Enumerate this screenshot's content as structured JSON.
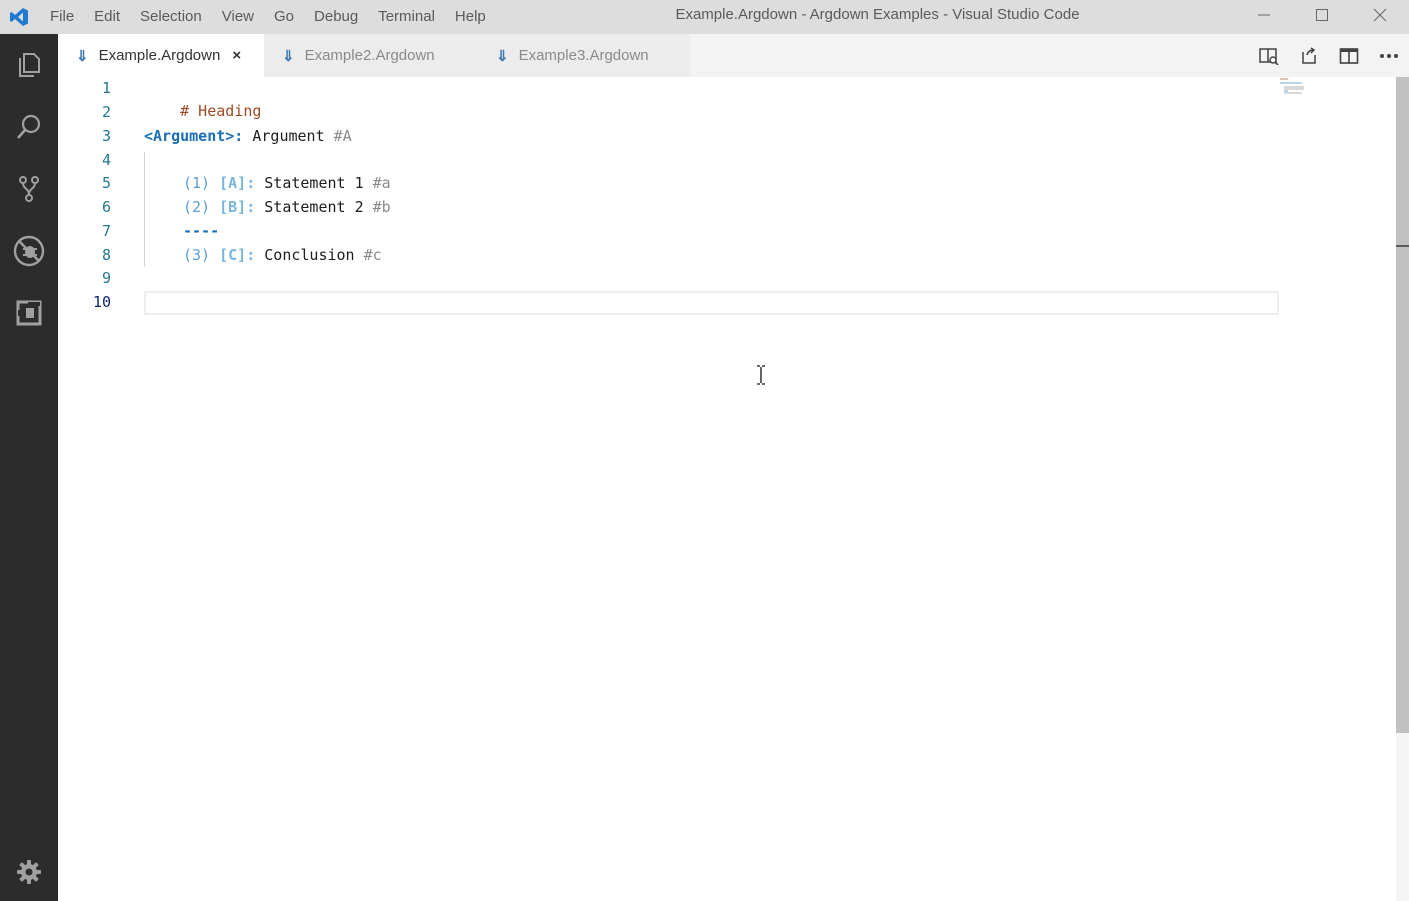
{
  "titlebar": {
    "menu": [
      "File",
      "Edit",
      "Selection",
      "View",
      "Go",
      "Debug",
      "Terminal",
      "Help"
    ],
    "title": "Example.Argdown - Argdown Examples - Visual Studio Code"
  },
  "activitybar": {
    "items": [
      "explorer-icon",
      "search-icon",
      "source-control-icon",
      "debug-icon",
      "extensions-icon"
    ],
    "bottom": "gear-icon"
  },
  "tabs": [
    {
      "label": "Example.Argdown",
      "active": true,
      "close": "×"
    },
    {
      "label": "Example2.Argdown",
      "active": false
    },
    {
      "label": "Example3.Argdown",
      "active": false
    }
  ],
  "editor_actions": [
    "open-preview-icon",
    "open-file-icon",
    "split-editor-icon",
    "more-actions-icon"
  ],
  "editor": {
    "line_numbers": [
      "1",
      "2",
      "3",
      "4",
      "5",
      "6",
      "7",
      "8",
      "9",
      "10"
    ],
    "lines": {
      "l1": {
        "heading": "# Heading"
      },
      "l3": {
        "arg": "<Argument>:",
        "text": " Argument ",
        "tag": "#A"
      },
      "l5": {
        "num": "(1) ",
        "ref": "[A]:",
        "text": " Statement 1 ",
        "tag": "#a"
      },
      "l6": {
        "num": "(2) ",
        "ref": "[B]:",
        "text": " Statement 2 ",
        "tag": "#b"
      },
      "l7": {
        "sep": "----"
      },
      "l8": {
        "num": "(3) ",
        "ref": "[C]:",
        "text": " Conclusion ",
        "tag": "#c"
      }
    }
  },
  "colors": {
    "activitybar": "#2c2c2c",
    "titlebar": "#dddddd",
    "accent": "#007acc"
  }
}
